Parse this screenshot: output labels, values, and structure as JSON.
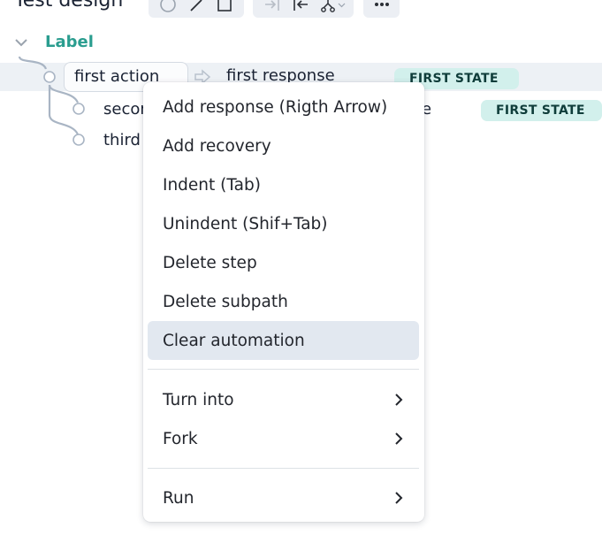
{
  "header": {
    "title": "Test design",
    "toolbar_groups": [
      {
        "icons": [
          "circle-icon",
          "line-icon",
          "square-icon"
        ]
      },
      {
        "icons": [
          "indent-icon",
          "unindent-icon",
          "fork-icon",
          "chevron-down-icon"
        ]
      },
      {
        "icons": [
          "more-icon"
        ]
      }
    ]
  },
  "tree": {
    "label": "Label",
    "steps": [
      {
        "action": "first action",
        "response": "first response",
        "state": "FIRST STATE"
      },
      {
        "action": "second",
        "response_tail": "e",
        "state": "FIRST STATE"
      },
      {
        "action": "third"
      }
    ]
  },
  "context_menu": {
    "items": [
      {
        "label": "Add response (Rigth Arrow)"
      },
      {
        "label": "Add recovery"
      },
      {
        "label": "Indent (Tab)"
      },
      {
        "label": "Unindent (Shif+Tab)"
      },
      {
        "label": "Delete step"
      },
      {
        "label": "Delete subpath"
      },
      {
        "label": "Clear automation",
        "highlighted": true
      }
    ],
    "submenu_items": [
      {
        "label": "Turn into"
      },
      {
        "label": "Fork"
      }
    ],
    "run_item": {
      "label": "Run"
    }
  },
  "colors": {
    "label_accent": "#2a9d8f",
    "badge_bg": "#d2f0ec",
    "badge_text": "#0f3d3a",
    "highlight_bg": "#e2e8f0"
  }
}
